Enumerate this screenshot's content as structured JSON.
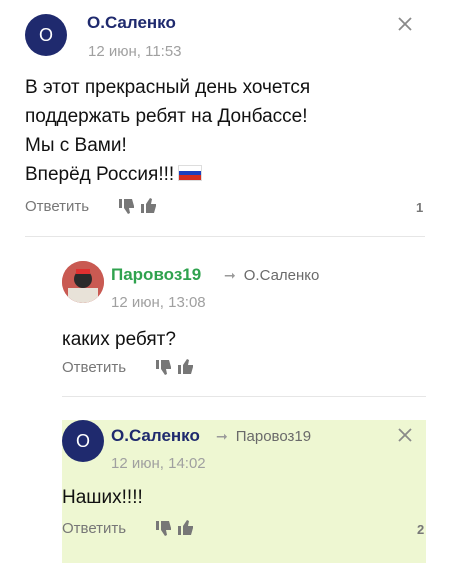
{
  "comments": [
    {
      "avatar_letter": "О",
      "author": "О.Саленко",
      "date": "12 июн, 11:53",
      "lines": [
        "В этот прекрасный день хочется",
        "поддержать ребят на Донбассе!",
        "Мы с Вами!",
        "Вперёд Россия!!!"
      ],
      "reply_label": "Ответить",
      "count": "1"
    },
    {
      "author": "Паровоз19",
      "reply_to": "О.Саленко",
      "date": "12 июн, 13:08",
      "text": "каких ребят?",
      "reply_label": "Ответить"
    },
    {
      "avatar_letter": "О",
      "author": "О.Саленко",
      "reply_to": "Паровоз19",
      "date": "12 июн, 14:02",
      "text": "Наших!!!!",
      "reply_label": "Ответить",
      "count": "2"
    }
  ],
  "colors": {
    "avatar_bg": "#1f2a6e",
    "author_blue": "#1f2a6e",
    "author_green": "#2fa24e",
    "highlight_bg": "#eef7d2"
  },
  "icons": [
    "close-icon",
    "dislike-icon",
    "like-icon",
    "reply-arrow-icon",
    "russia-flag-icon"
  ]
}
